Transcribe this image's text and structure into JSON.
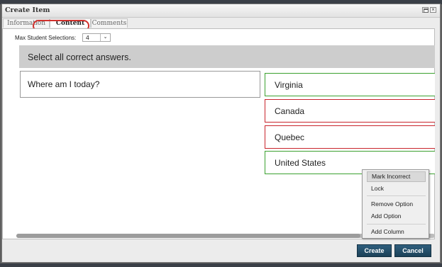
{
  "window": {
    "title": "Create Item",
    "max_icon": "maximize-icon",
    "close_glyph": "×"
  },
  "tabs": [
    {
      "label": "Information"
    },
    {
      "label": "Content",
      "active": true
    },
    {
      "label": "Comments"
    }
  ],
  "max_selections": {
    "label": "Max Student Selections:",
    "value": "4",
    "arrow": "⌄"
  },
  "instruction": "Select all correct answers.",
  "question": "Where am I today?",
  "options": [
    {
      "text": "Virginia",
      "status": "correct"
    },
    {
      "text": "Canada",
      "status": "incorrect"
    },
    {
      "text": "Quebec",
      "status": "incorrect"
    },
    {
      "text": "United States",
      "status": "correct"
    }
  ],
  "context_menu": {
    "mark_incorrect": "Mark Incorrect",
    "lock": "Lock",
    "remove_option": "Remove Option",
    "add_option": "Add Option",
    "add_column": "Add Column"
  },
  "buttons": {
    "create": "Create",
    "cancel": "Cancel"
  },
  "colors": {
    "correct": "#3ba12f",
    "incorrect": "#c8242c",
    "tab_highlight": "#d0312d",
    "primary_button": "#1c4158"
  }
}
